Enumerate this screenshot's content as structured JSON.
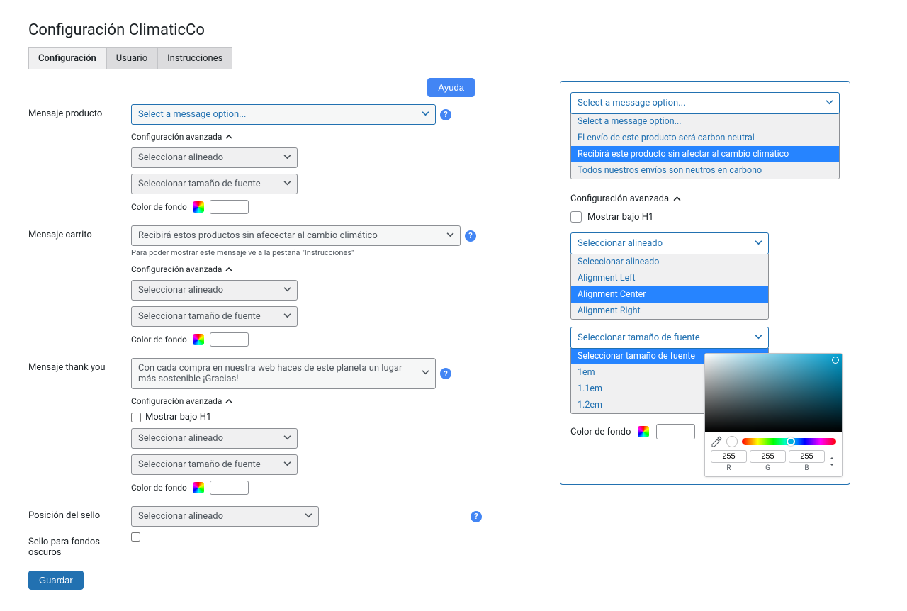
{
  "page_title": "Configuración ClimaticCo",
  "tabs": {
    "config": "Configuración",
    "user": "Usuario",
    "instr": "Instrucciones"
  },
  "help_button": "Ayuda",
  "save_button": "Guardar",
  "adv_config_label": "Configuración avanzada",
  "color_label": "Color de fondo",
  "product": {
    "label": "Mensaje producto",
    "select": "Select a message option...",
    "align": "Seleccionar alineado",
    "font": "Seleccionar tamaño de fuente"
  },
  "cart": {
    "label": "Mensaje carrito",
    "select": "Recibirá estos productos sin afecectar al cambio climático",
    "hint": "Para poder mostrar este mensaje ve a la pestaña \"Instrucciones\"",
    "align": "Seleccionar alineado",
    "font": "Seleccionar tamaño de fuente"
  },
  "thankyou": {
    "label": "Mensaje thank you",
    "select": "Con cada compra en nuestra web haces de este planeta un lugar más sostenible ¡Gracias!",
    "show_h1": "Mostrar bajo H1",
    "align": "Seleccionar alineado",
    "font": "Seleccionar tamaño de fuente"
  },
  "stamp_pos": {
    "label": "Posición del sello",
    "select": "Seleccionar alineado"
  },
  "dark_stamp": {
    "label": "Sello para fondos oscuros"
  },
  "right": {
    "msg_select": "Select a message option...",
    "msg_opts": [
      "Select a message option...",
      "El envío de este producto será carbon neutral",
      "Recibirá este producto sin afectar al cambio climático",
      "Todos nuestros envíos son neutros en carbono"
    ],
    "msg_hl_index": 2,
    "adv": "Configuración avanzada",
    "show_h1": "Mostrar bajo H1",
    "align_select": "Seleccionar alineado",
    "align_opts": [
      "Seleccionar alineado",
      "Alignment Left",
      "Alignment Center",
      "Alignment Right"
    ],
    "align_hl_index": 2,
    "font_select": "Seleccionar tamaño de fuente",
    "font_opts": [
      "Seleccionar tamaño de fuente",
      "1em",
      "1.1em",
      "1.2em"
    ],
    "font_hl_index": 0,
    "color_label": "Color de fondo",
    "picker": {
      "r": "255",
      "g": "255",
      "b": "255",
      "rl": "R",
      "gl": "G",
      "bl": "B"
    }
  }
}
